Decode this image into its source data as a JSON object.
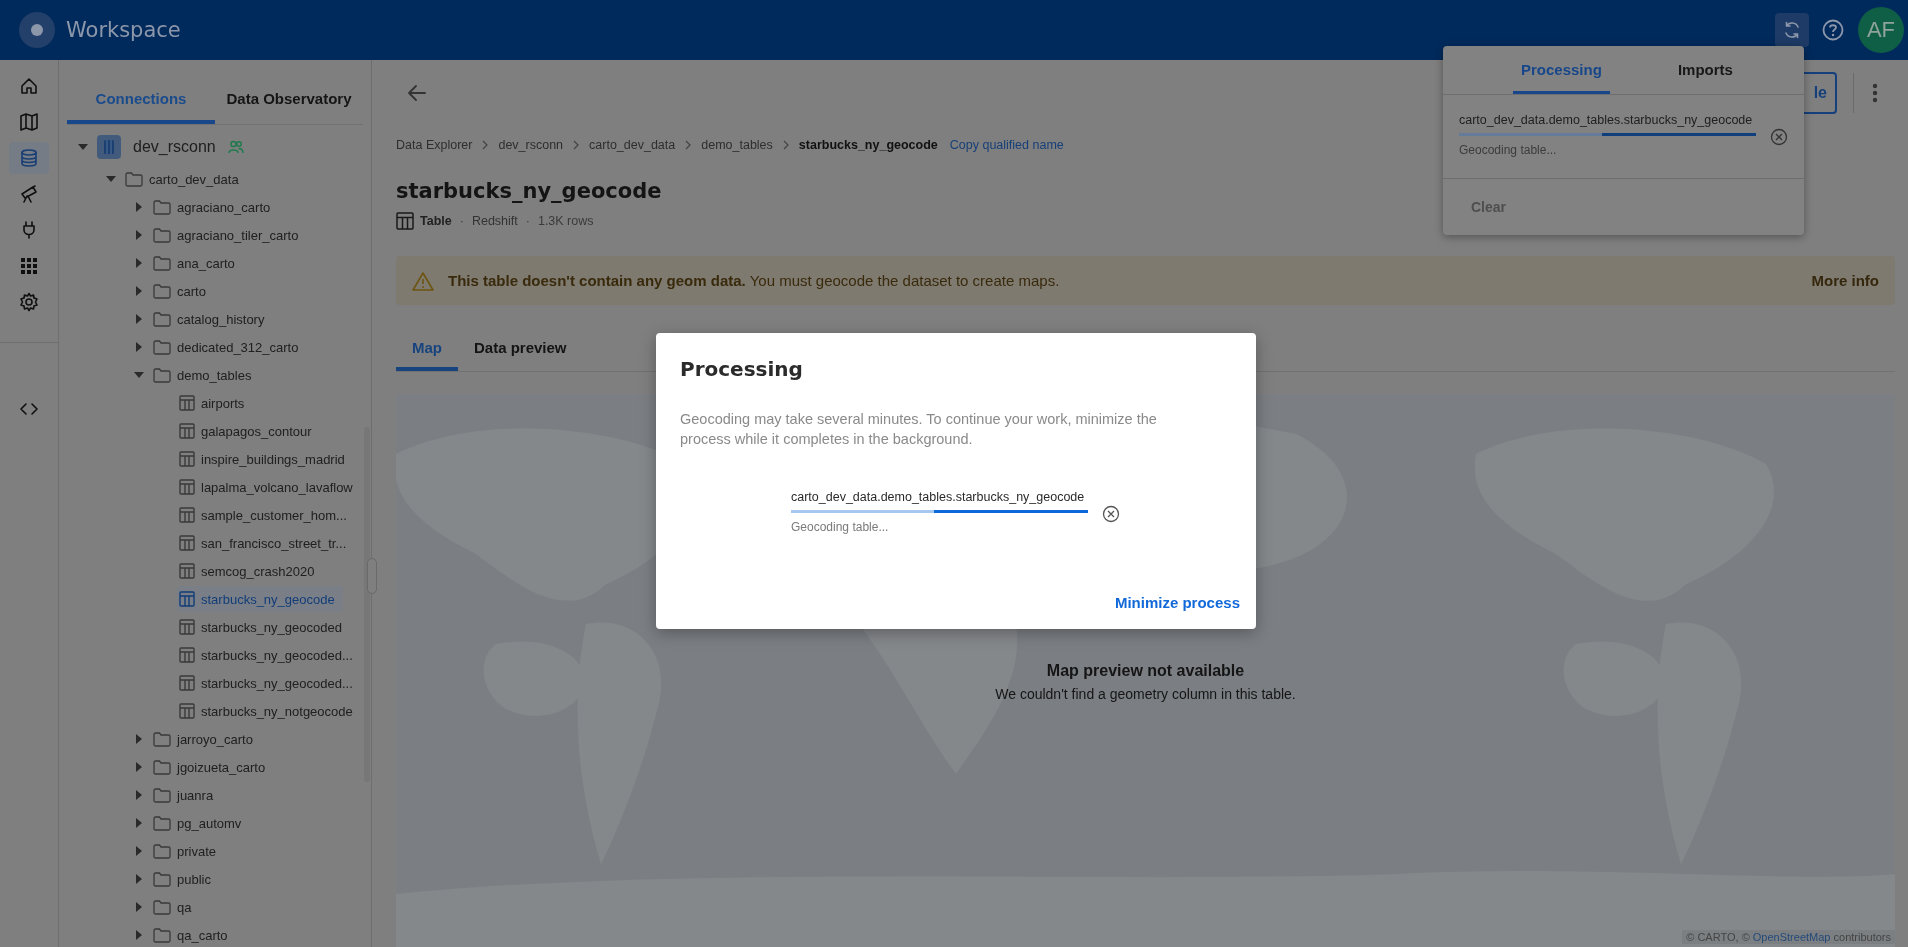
{
  "app_bar": {
    "title": "Workspace",
    "avatar": "AF",
    "sync_active": true
  },
  "nav_rail": {
    "items": [
      {
        "kind": "home",
        "selected": false
      },
      {
        "kind": "map",
        "selected": false
      },
      {
        "kind": "database",
        "selected": true
      },
      {
        "kind": "telescope",
        "selected": false
      },
      {
        "kind": "plug",
        "selected": false
      },
      {
        "kind": "grid",
        "selected": false
      },
      {
        "kind": "gear",
        "selected": false
      },
      {
        "kind": "code",
        "selected": false
      }
    ]
  },
  "sidebar": {
    "tabs": [
      {
        "label": "Connections",
        "selected": true
      },
      {
        "label": "Data Observatory",
        "selected": false
      }
    ],
    "tree": [
      {
        "kind": "connection",
        "label": "dev_rsconn",
        "shared": true,
        "expanded": true,
        "selected": false,
        "children": [
          {
            "kind": "folder",
            "label": "carto_dev_data",
            "expanded": true,
            "selected": false,
            "children": [
              {
                "kind": "folder",
                "label": "agraciano_carto",
                "expanded": false,
                "selected": false
              },
              {
                "kind": "folder",
                "label": "agraciano_tiler_carto",
                "expanded": false,
                "selected": false
              },
              {
                "kind": "folder",
                "label": "ana_carto",
                "expanded": false,
                "selected": false
              },
              {
                "kind": "folder",
                "label": "carto",
                "expanded": false,
                "selected": false
              },
              {
                "kind": "folder",
                "label": "catalog_history",
                "expanded": false,
                "selected": false
              },
              {
                "kind": "folder",
                "label": "dedicated_312_carto",
                "expanded": false,
                "selected": false
              },
              {
                "kind": "folder",
                "label": "demo_tables",
                "expanded": true,
                "selected": false,
                "children": [
                  {
                    "kind": "table",
                    "label": "airports",
                    "selected": false
                  },
                  {
                    "kind": "table",
                    "label": "galapagos_contour",
                    "selected": false
                  },
                  {
                    "kind": "table",
                    "label": "inspire_buildings_madrid",
                    "selected": false
                  },
                  {
                    "kind": "table",
                    "label": "lapalma_volcano_lavaflow",
                    "selected": false
                  },
                  {
                    "kind": "table",
                    "label": "sample_customer_hom...",
                    "selected": false
                  },
                  {
                    "kind": "table",
                    "label": "san_francisco_street_tr...",
                    "selected": false
                  },
                  {
                    "kind": "table",
                    "label": "semcog_crash2020",
                    "selected": false
                  },
                  {
                    "kind": "table",
                    "label": "starbucks_ny_geocode",
                    "selected": true
                  },
                  {
                    "kind": "table",
                    "label": "starbucks_ny_geocoded",
                    "selected": false
                  },
                  {
                    "kind": "table",
                    "label": "starbucks_ny_geocoded...",
                    "selected": false
                  },
                  {
                    "kind": "table",
                    "label": "starbucks_ny_geocoded...",
                    "selected": false
                  },
                  {
                    "kind": "table",
                    "label": "starbucks_ny_notgeocode",
                    "selected": false
                  }
                ]
              },
              {
                "kind": "folder",
                "label": "jarroyo_carto",
                "expanded": false,
                "selected": false
              },
              {
                "kind": "folder",
                "label": "jgoizueta_carto",
                "expanded": false,
                "selected": false
              },
              {
                "kind": "folder",
                "label": "juanra",
                "expanded": false,
                "selected": false
              },
              {
                "kind": "folder",
                "label": "pg_automv",
                "expanded": false,
                "selected": false
              },
              {
                "kind": "folder",
                "label": "private",
                "expanded": false,
                "selected": false
              },
              {
                "kind": "folder",
                "label": "public",
                "expanded": false,
                "selected": false
              },
              {
                "kind": "folder",
                "label": "qa",
                "expanded": false,
                "selected": false
              },
              {
                "kind": "folder",
                "label": "qa_carto",
                "expanded": false,
                "selected": false
              }
            ]
          }
        ]
      }
    ]
  },
  "breadcrumb": {
    "items": [
      "Data Explorer",
      "dev_rsconn",
      "carto_dev_data",
      "demo_tables",
      "starbucks_ny_geocode"
    ],
    "copy_link": "Copy qualified name"
  },
  "title": "starbucks_ny_geocode",
  "meta": [
    {
      "kind": "type",
      "text": "Table"
    },
    {
      "kind": "separator",
      "text": "·"
    },
    {
      "kind": "text",
      "text": "Redshift"
    },
    {
      "kind": "separator",
      "text": "·"
    },
    {
      "kind": "muted",
      "text": "1.3K rows"
    }
  ],
  "toolbar": {
    "button": "le"
  },
  "banner": {
    "text": "**This table doesn't contain any geom data.** You must geocode the dataset to create maps.",
    "action": "More info"
  },
  "tabs": [
    {
      "label": "Map",
      "selected": true
    },
    {
      "label": "Data preview",
      "selected": false
    }
  ],
  "map": {
    "kind": "picture",
    "title": "Map preview not available",
    "message": "We couldn't find a geometry column in this table.",
    "attribution": {
      "prefix": "© CARTO, ©",
      "link": "OpenStreetMap",
      "suffix": "contributors"
    }
  },
  "popover": {
    "tabs": [
      {
        "label": "Processing",
        "selected": true
      },
      {
        "label": "Imports",
        "selected": false
      }
    ],
    "items": [
      {
        "name": "carto_dev_data.demo_tables.starbucks_ny_geocode",
        "level": 0.48,
        "status": "Geocoding table..."
      }
    ],
    "clear": {
      "label": "Clear",
      "disabled": true
    }
  },
  "dialog": {
    "title": "Processing",
    "description": "Geocoding may take several minutes. To continue your work, minimize the process while it completes in the background.",
    "items": [
      {
        "name": "carto_dev_data.demo_tables.starbucks_ny_geocode",
        "level": 0.48,
        "status": "Geocoding table..."
      }
    ],
    "action": "Minimize process"
  }
}
